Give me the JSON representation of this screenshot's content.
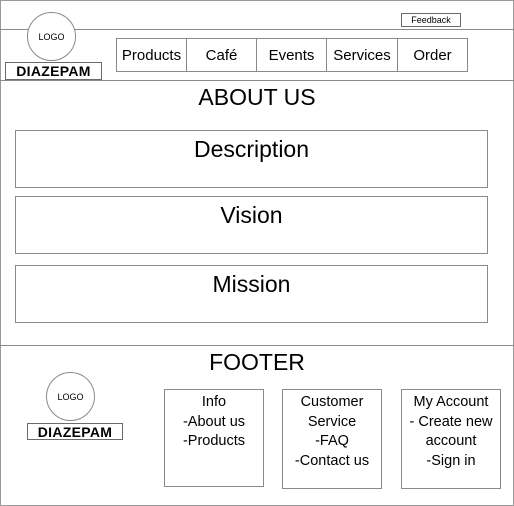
{
  "header": {
    "logo_text": "LOGO",
    "brand": "DIAZEPAM",
    "feedback_label": "Feedback",
    "nav": [
      "Products",
      "Café",
      "Events",
      "Services",
      "Order"
    ]
  },
  "main": {
    "title": "ABOUT US",
    "sections": [
      "Description",
      "Vision",
      "Mission"
    ]
  },
  "footer": {
    "title": "FOOTER",
    "logo_text": "LOGO",
    "brand": "DIAZEPAM",
    "columns": [
      {
        "lines": [
          "Info",
          "-About us",
          "-Products"
        ]
      },
      {
        "lines": [
          "Customer",
          "Service",
          "-FAQ",
          "-Contact us"
        ]
      },
      {
        "lines": [
          "My Account",
          "- Create new",
          "account",
          "-Sign in"
        ]
      }
    ]
  }
}
